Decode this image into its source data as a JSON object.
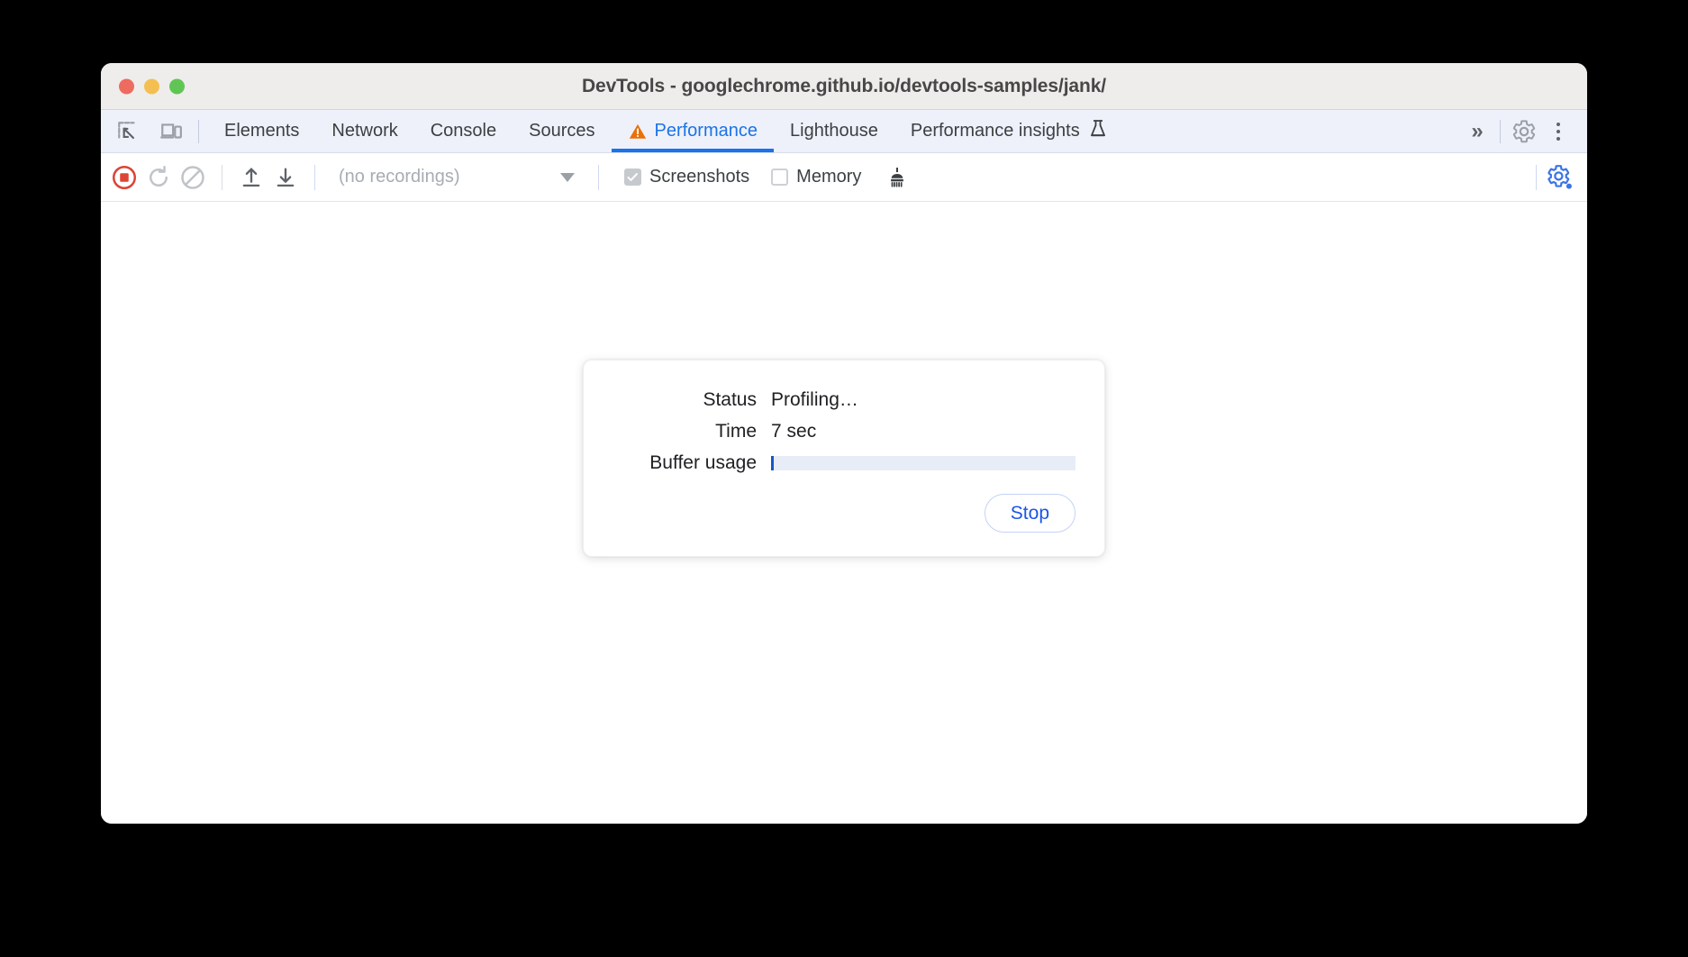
{
  "window": {
    "title": "DevTools - googlechrome.github.io/devtools-samples/jank/",
    "traffic_lights": {
      "close_label": "close-window",
      "minimize_label": "minimize-window",
      "maximize_label": "maximize-window"
    }
  },
  "tabbar": {
    "left_icons": [
      {
        "name": "inspect-element-icon",
        "title": "Inspect element"
      },
      {
        "name": "device-toolbar-icon",
        "title": "Toggle device toolbar"
      }
    ],
    "tabs": [
      {
        "label": "Elements",
        "active": false
      },
      {
        "label": "Network",
        "active": false
      },
      {
        "label": "Console",
        "active": false
      },
      {
        "label": "Sources",
        "active": false
      },
      {
        "label": "Performance",
        "active": true,
        "badge": "warning-triangle-icon"
      },
      {
        "label": "Lighthouse",
        "active": false
      },
      {
        "label": "Performance insights",
        "active": false,
        "badge": "experiment-flask-icon"
      }
    ],
    "more_tabs_label": "»",
    "settings_title": "Settings",
    "more_options_title": "Customize and control DevTools",
    "accent_color": "#1a73e8",
    "warning_color": "#e8710a",
    "background": "#eef1fa"
  },
  "perf_toolbar": {
    "record_title": "Stop recording",
    "record_color": "#db4437",
    "reload_title": "Record and reload",
    "clear_title": "Clear",
    "load_profile_title": "Load profile",
    "save_profile_title": "Save profile",
    "recording_select": {
      "value": "(no recordings)",
      "caret": "chevron-down-icon"
    },
    "checkboxes": [
      {
        "label": "Screenshots",
        "checked": true,
        "check_glyph": "✓"
      },
      {
        "label": "Memory",
        "checked": false,
        "check_glyph": ""
      }
    ],
    "gc_title": "Collect garbage",
    "capture_settings_title": "Capture settings",
    "capture_settings_color": "#3b74e8"
  },
  "status_card": {
    "rows": [
      {
        "label": "Status",
        "value": "Profiling…",
        "type": "text"
      },
      {
        "label": "Time",
        "value": "7 sec",
        "type": "text"
      },
      {
        "label": "Buffer usage",
        "value": "",
        "type": "progress",
        "percent": 1
      }
    ],
    "stop_label": "Stop",
    "progress": {
      "percent": 1,
      "fill_color": "#1a56c4",
      "track_color": "#e8ecf7"
    }
  }
}
